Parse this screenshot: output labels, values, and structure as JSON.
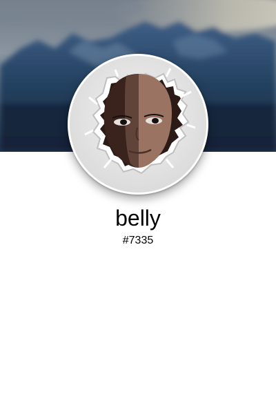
{
  "profile": {
    "username": "belly",
    "discriminator": "#7335"
  },
  "icons": {
    "avatar": "bald-face-through-torn-paper-icon",
    "cover": "misty-mountains-banner-image"
  },
  "colors": {
    "page_background": "#ffffff",
    "avatar_ring": "#ffffff",
    "banner_sky": "#8a97a6",
    "banner_mountains": "#1f3f63",
    "skin_light": "#9a7363",
    "skin_shadow": "#3a231d"
  }
}
